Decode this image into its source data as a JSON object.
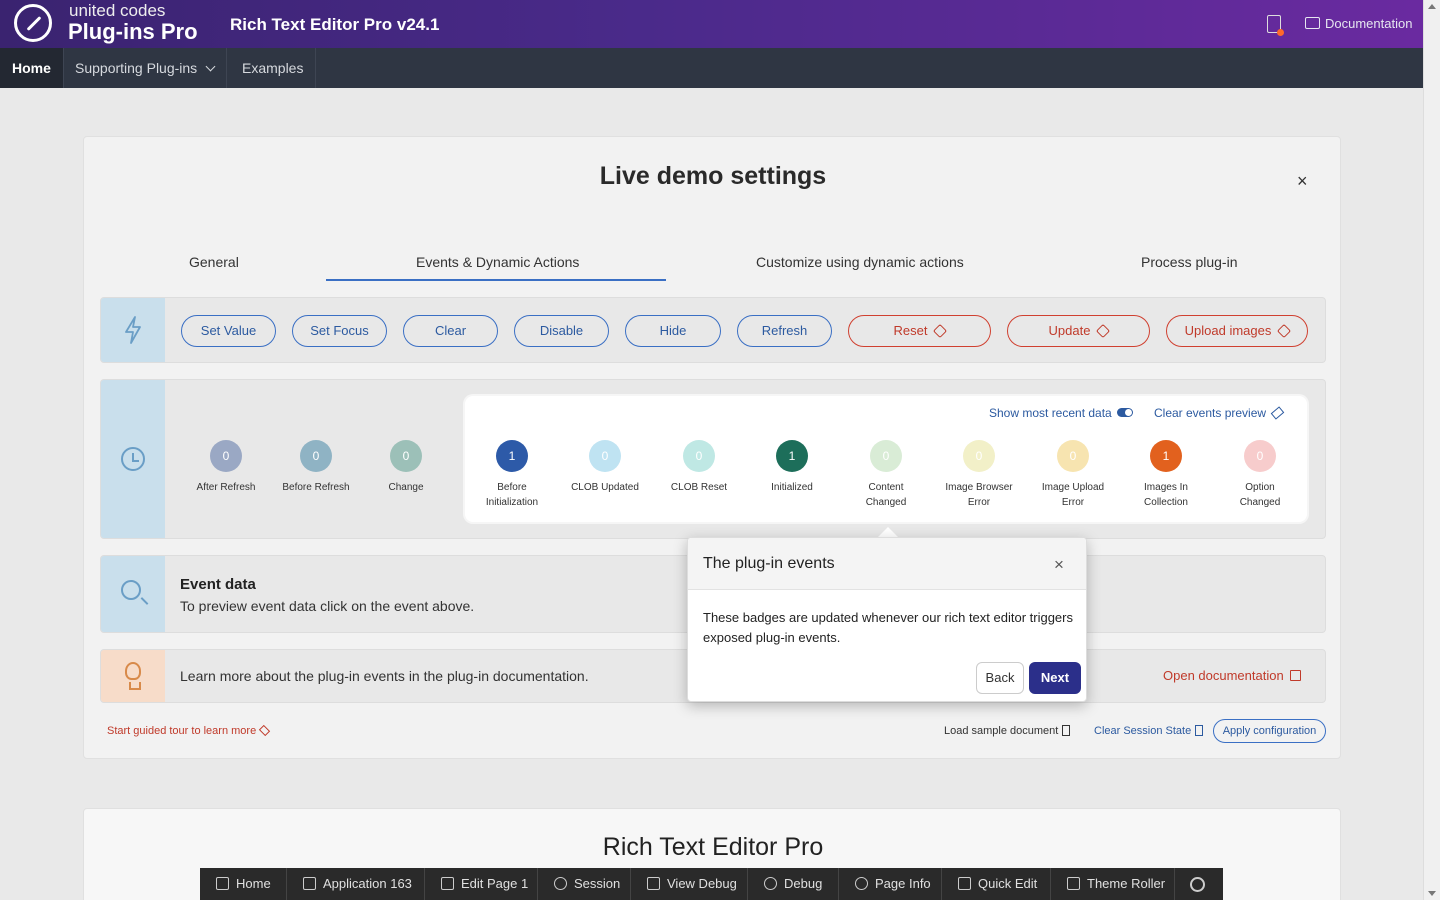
{
  "header": {
    "brand_top": "united codes",
    "brand_main": "Plug-ins Pro",
    "app_title": "Rich Text Editor Pro v24.1",
    "documentation": "Documentation"
  },
  "nav": {
    "home": "Home",
    "supporting": "Supporting Plug-ins",
    "examples": "Examples"
  },
  "card": {
    "title": "Live demo settings",
    "close": "×",
    "tabs": [
      "General",
      "Events & Dynamic Actions",
      "Customize using dynamic actions",
      "Process plug-in"
    ],
    "active_tab": "Events & Dynamic Actions"
  },
  "actions": {
    "buttons": [
      "Set Value",
      "Set Focus",
      "Clear",
      "Disable",
      "Hide",
      "Refresh"
    ],
    "plugin_buttons": [
      "Reset",
      "Update",
      "Upload images"
    ]
  },
  "events_preview": {
    "show_recent": "Show most recent data",
    "clear_preview": "Clear events preview",
    "dimmed_badges": [
      {
        "count": "0",
        "label": "After Refresh",
        "color": "#9aa8c4"
      },
      {
        "count": "0",
        "label": "Before Refresh",
        "color": "#8fb3c4"
      },
      {
        "count": "0",
        "label": "Change",
        "color": "#9cc0b8"
      }
    ],
    "badges": [
      {
        "count": "1",
        "label1": "Before",
        "label2": "Initialization",
        "color": "#2d5aa8",
        "text": "#ffffff"
      },
      {
        "count": "0",
        "label1": "CLOB Updated",
        "label2": "",
        "color": "#bfe3f2",
        "text": "#ffffff"
      },
      {
        "count": "0",
        "label1": "CLOB Reset",
        "label2": "",
        "color": "#bfe8e4",
        "text": "#ffffff"
      },
      {
        "count": "1",
        "label1": "Initialized",
        "label2": "",
        "color": "#1d6e5a",
        "text": "#ffffff"
      },
      {
        "count": "0",
        "label1": "Content",
        "label2": "Changed",
        "color": "#d9ecd6",
        "text": "#ffffff"
      },
      {
        "count": "0",
        "label1": "Image Browser",
        "label2": "Error",
        "color": "#f2f0c8",
        "text": "#ffffff"
      },
      {
        "count": "0",
        "label1": "Image Upload",
        "label2": "Error",
        "color": "#f7e4b0",
        "text": "#ffffff"
      },
      {
        "count": "1",
        "label1": "Images In",
        "label2": "Collection",
        "color": "#e2611e",
        "text": "#ffffff"
      },
      {
        "count": "0",
        "label1": "Option",
        "label2": "Changed",
        "color": "#f7cccc",
        "text": "#ffffff"
      }
    ]
  },
  "event_data": {
    "title": "Event data",
    "desc": "To preview event data click on the event above."
  },
  "learn": {
    "text": "Learn more about the plug-in events in the plug-in documentation.",
    "link": "Open documentation"
  },
  "footer": {
    "guided": "Start guided tour to learn more",
    "load_sample": "Load sample document",
    "clear_session": "Clear Session State",
    "apply": "Apply configuration"
  },
  "popover": {
    "title": "The plug-in events",
    "close": "×",
    "body": "These badges are updated whenever our rich text editor triggers exposed plug-in events.",
    "back": "Back",
    "next": "Next"
  },
  "card2": {
    "title": "Rich Text Editor Pro"
  },
  "devbar": {
    "items": [
      "Home",
      "Application 163",
      "Edit Page 1",
      "Session",
      "View Debug",
      "Debug",
      "Page Info",
      "Quick Edit",
      "Theme Roller"
    ]
  }
}
